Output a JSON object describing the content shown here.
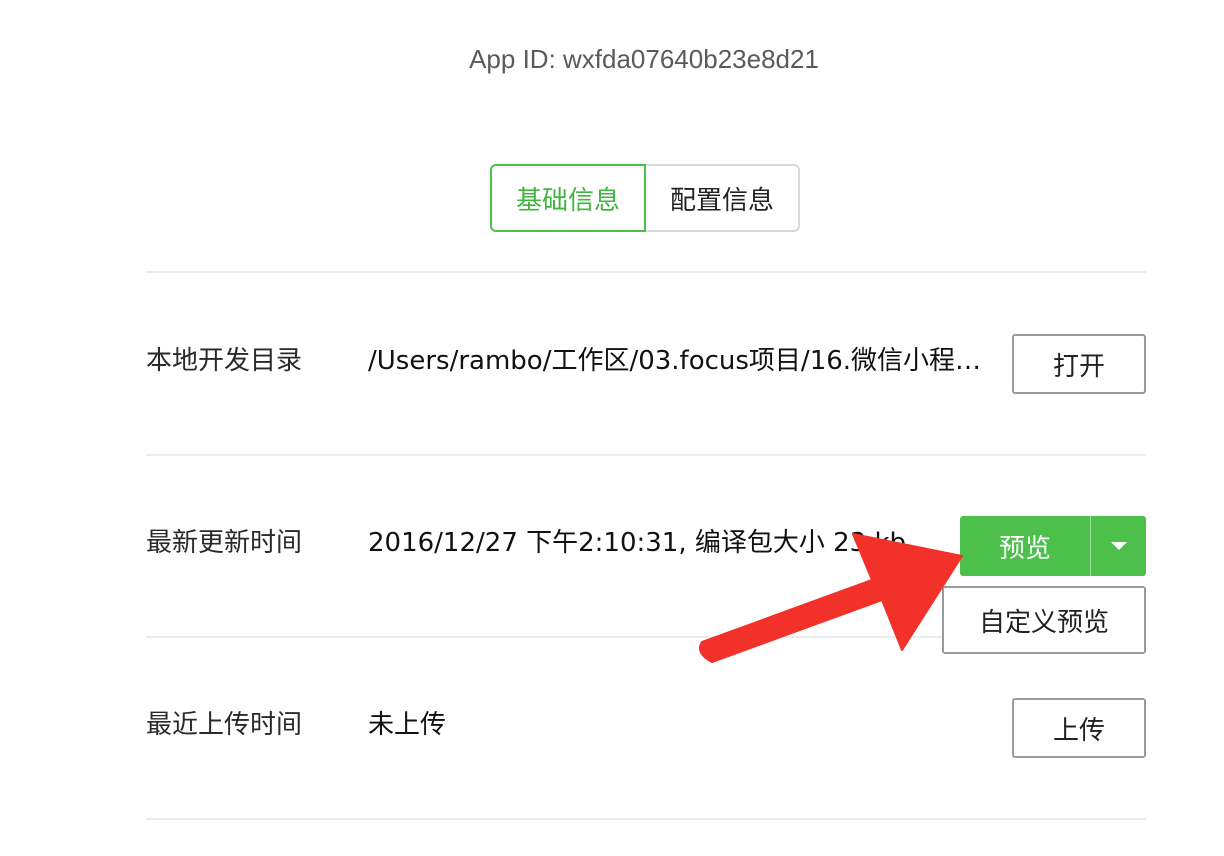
{
  "app_id": "App ID: wxfda07640b23e8d21",
  "tabs": [
    {
      "label": "基础信息",
      "active": true
    },
    {
      "label": "配置信息",
      "active": false
    }
  ],
  "rows": {
    "local_dir": {
      "label": "本地开发目录",
      "value": "/Users/rambo/工作区/03.focus项目/16.微信小程…",
      "button": "打开"
    },
    "latest_update": {
      "label": "最新更新时间",
      "value": "2016/12/27 下午2:10:31, 编译包大小 23 kb",
      "preview_button": "预览",
      "menu_item": "自定义预览"
    },
    "last_upload": {
      "label": "最近上传时间",
      "value": "未上传",
      "button": "上传"
    }
  },
  "colors": {
    "accent": "#4cc04b",
    "annotation_arrow": "#f2312a"
  }
}
